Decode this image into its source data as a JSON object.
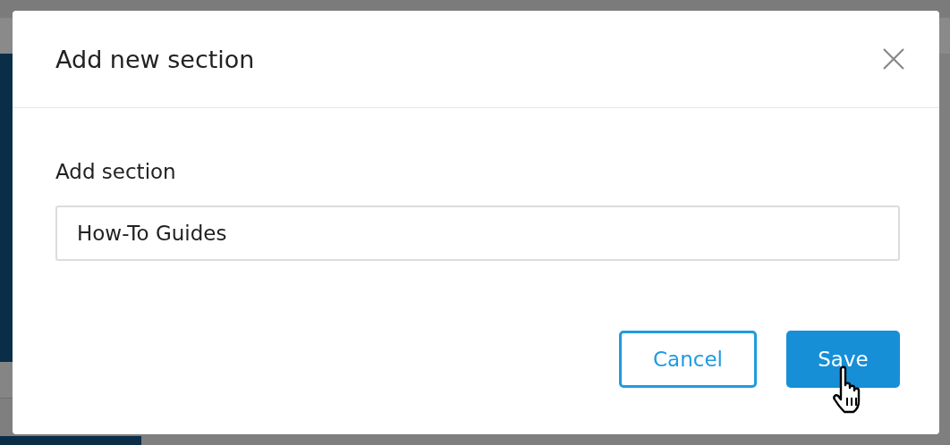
{
  "dialog": {
    "title": "Add new section",
    "field": {
      "label": "Add section",
      "value": "How-To Guides"
    },
    "buttons": [
      {
        "label": "Cancel",
        "kind": "secondary"
      },
      {
        "label": "Save",
        "kind": "primary"
      }
    ]
  }
}
